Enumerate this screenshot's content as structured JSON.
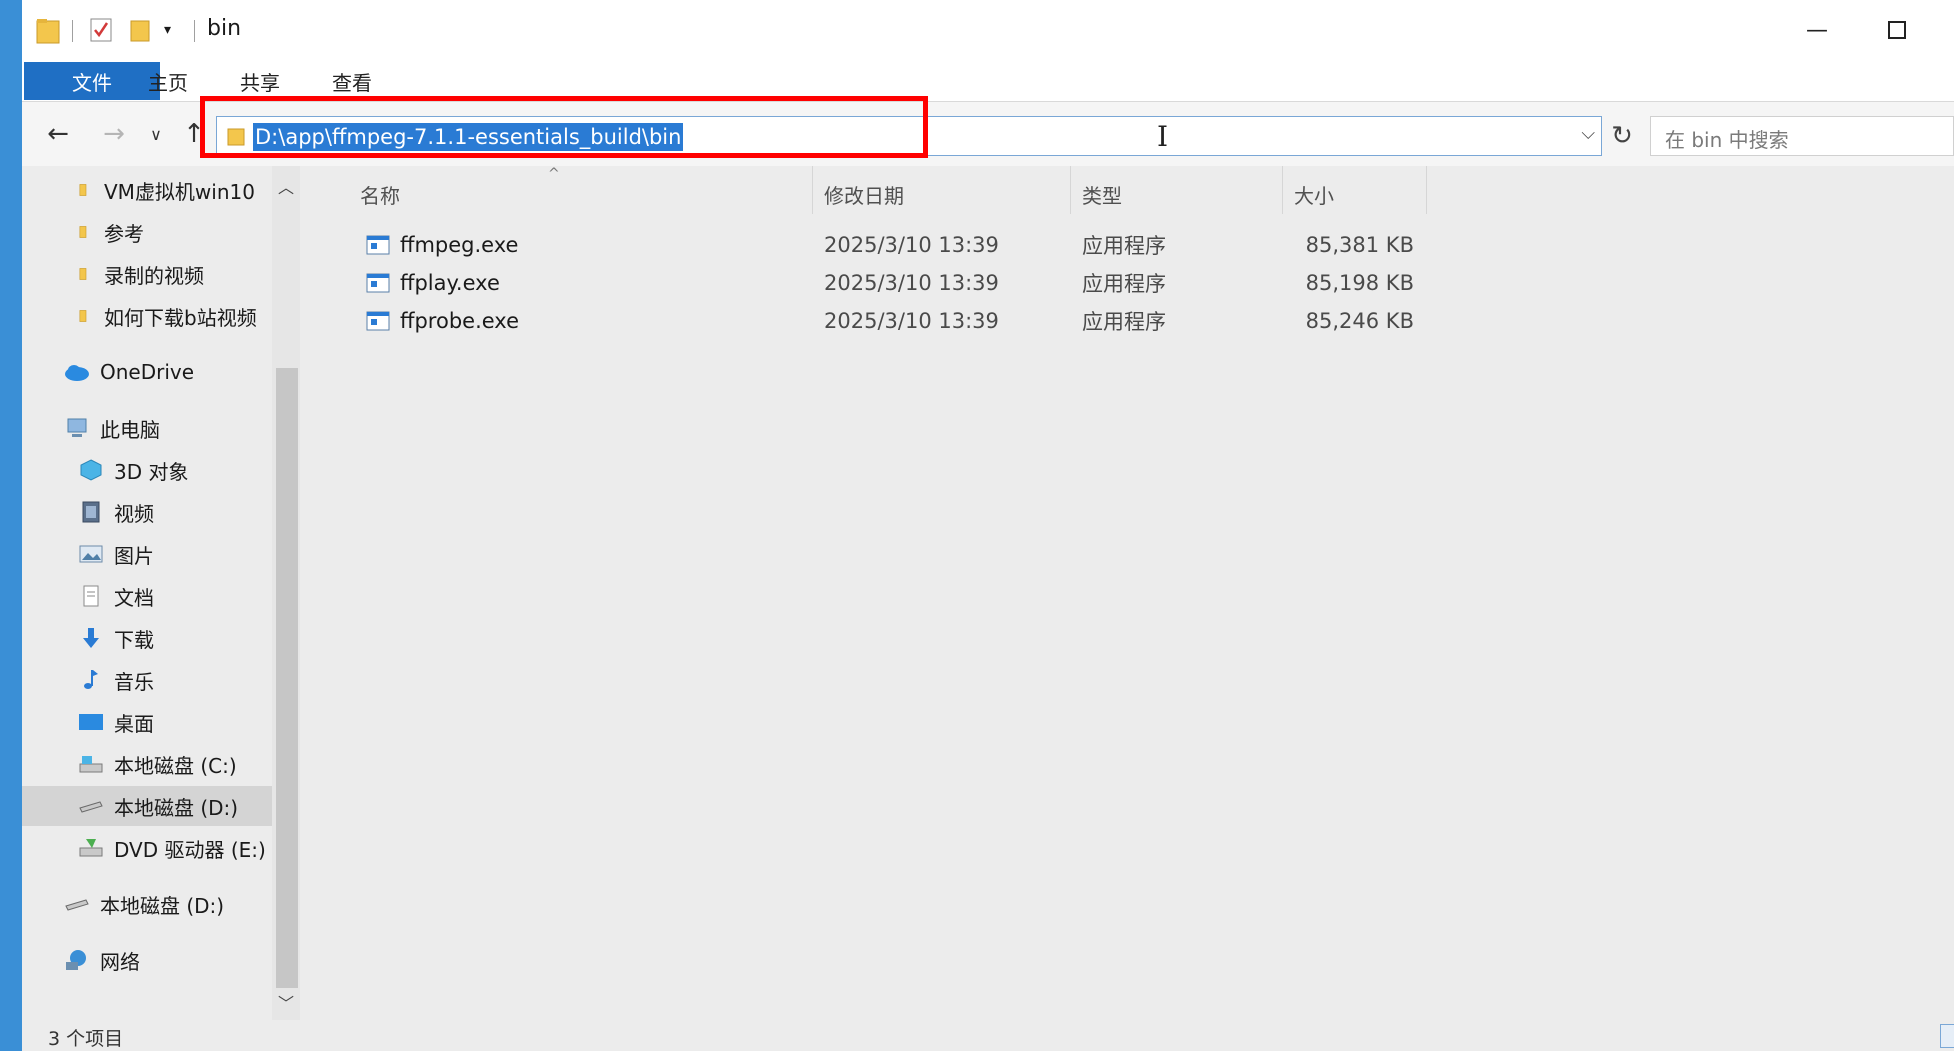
{
  "window": {
    "title": "bin"
  },
  "ribbon": {
    "tabs": [
      "文件",
      "主页",
      "共享",
      "查看"
    ]
  },
  "address_bar": {
    "path": "D:\\app\\ffmpeg-7.1.1-essentials_build\\bin"
  },
  "search": {
    "placeholder": "在 bin 中搜索"
  },
  "nav_pane": {
    "items": [
      {
        "label": "VM虚拟机win10",
        "icon": "folder-icon"
      },
      {
        "label": "参考",
        "icon": "folder-icon"
      },
      {
        "label": "录制的视频",
        "icon": "folder-icon"
      },
      {
        "label": "如何下载b站视频",
        "icon": "folder-icon"
      },
      {
        "label": "OneDrive",
        "icon": "onedrive-icon"
      },
      {
        "label": "此电脑",
        "icon": "computer-icon"
      },
      {
        "label": "3D 对象",
        "icon": "3d-objects-icon"
      },
      {
        "label": "视频",
        "icon": "video-icon"
      },
      {
        "label": "图片",
        "icon": "pictures-icon"
      },
      {
        "label": "文档",
        "icon": "documents-icon"
      },
      {
        "label": "下载",
        "icon": "download-icon"
      },
      {
        "label": "音乐",
        "icon": "music-icon"
      },
      {
        "label": "桌面",
        "icon": "desktop-icon"
      },
      {
        "label": "本地磁盘 (C:)",
        "icon": "drive-icon"
      },
      {
        "label": "本地磁盘 (D:)",
        "icon": "drive-icon"
      },
      {
        "label": "DVD 驱动器 (E:)",
        "icon": "dvd-icon"
      },
      {
        "label": "本地磁盘 (D:)",
        "icon": "drive-icon"
      },
      {
        "label": "网络",
        "icon": "network-icon"
      }
    ]
  },
  "file_list": {
    "columns": [
      "名称",
      "修改日期",
      "类型",
      "大小"
    ],
    "rows": [
      {
        "name": "ffmpeg.exe",
        "modified": "2025/3/10 13:39",
        "type": "应用程序",
        "size": "85,381 KB"
      },
      {
        "name": "ffplay.exe",
        "modified": "2025/3/10 13:39",
        "type": "应用程序",
        "size": "85,198 KB"
      },
      {
        "name": "ffprobe.exe",
        "modified": "2025/3/10 13:39",
        "type": "应用程序",
        "size": "85,246 KB"
      }
    ]
  },
  "status_bar": {
    "item_count": "3 个项目"
  },
  "colors": {
    "accent": "#1f6fc4",
    "selection": "#2a7bd4",
    "highlight_border": "#ff0000"
  }
}
